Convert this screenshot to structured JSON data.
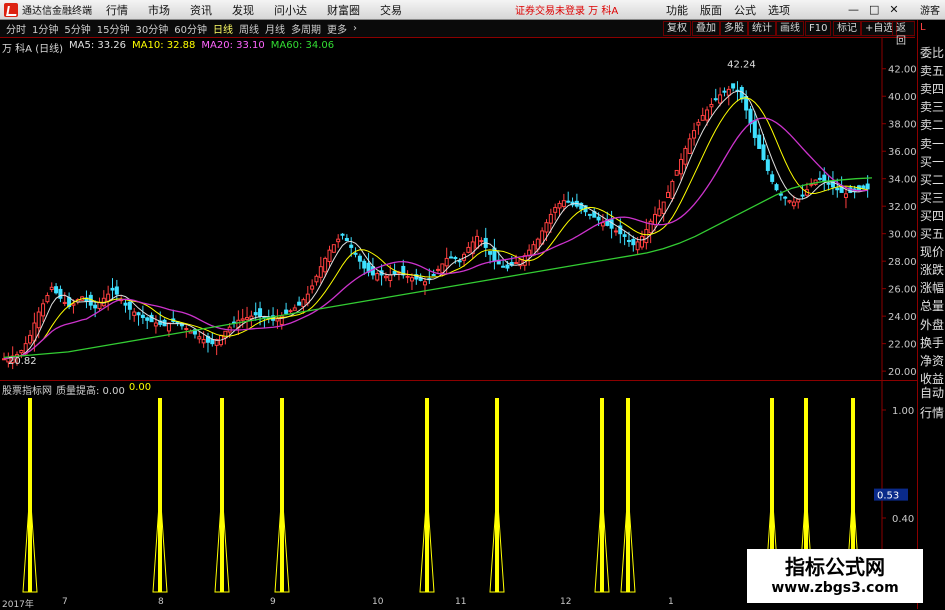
{
  "menubar": {
    "app_title": "通达信金融终端",
    "items": [
      "行情",
      "市场",
      "资讯",
      "发现",
      "问小达",
      "财富圈",
      "交易"
    ],
    "notice": "证券交易未登录  万 科A",
    "right_items": [
      "功能",
      "版面",
      "公式",
      "选项"
    ],
    "guest": "游客"
  },
  "periodbar": {
    "periods": [
      "分时",
      "1分钟",
      "5分钟",
      "15分钟",
      "30分钟",
      "60分钟",
      "日线",
      "周线",
      "月线",
      "多周期",
      "更多"
    ],
    "active_period": "日线",
    "tools": [
      "复权",
      "叠加",
      "多股",
      "统计",
      "画线",
      "F10",
      "标记",
      "+自选",
      "返回"
    ]
  },
  "chart_title": {
    "stock": "万 科A (日线)",
    "ma5": "MA5: 33.26",
    "ma10": "MA10: 32.88",
    "ma20": "MA20: 33.10",
    "ma60": "MA60: 34.06"
  },
  "price_axis": {
    "ticks": [
      "42.00",
      "40.00",
      "38.00",
      "36.00",
      "34.00",
      "32.00",
      "30.00",
      "28.00",
      "26.00",
      "24.00",
      "22.00",
      "20.00"
    ],
    "max_label": "42.24",
    "min_label": "20.82"
  },
  "indicator": {
    "name": "股票指标网",
    "label1": "质量提高: 0.00",
    "label2": "0.00",
    "axis_ticks": [
      "1.00",
      "0.40"
    ],
    "current_value": "0.53"
  },
  "dates": {
    "labels": [
      "2017年",
      "7",
      "8",
      "9",
      "10",
      "11",
      "12",
      "1"
    ]
  },
  "sidetabs": {
    "top_marker": "L",
    "tabs": [
      "委比",
      "卖五",
      "卖四",
      "卖三",
      "卖二",
      "卖一",
      "买一",
      "买二",
      "买三",
      "买四",
      "买五",
      "现价",
      "涨跌",
      "涨幅",
      "总量",
      "外盘",
      "换手",
      "净资",
      "收益",
      "自动",
      "行情"
    ]
  },
  "watermark": {
    "line1": "指标公式网",
    "line2": "www.zbgs3.com"
  },
  "colors": {
    "up": "#ff4040",
    "down": "#3fe0ff",
    "ma5": "#e0e0e0",
    "ma10": "#ffff00",
    "ma20": "#cc33cc",
    "ma60": "#33cc33",
    "signal": "#ffff00"
  },
  "chart_data": {
    "type": "candlestick",
    "ylim": [
      19.5,
      43
    ],
    "closes": [
      20.9,
      21.0,
      21.1,
      21.2,
      21.5,
      22.0,
      22.6,
      23.5,
      24.3,
      24.9,
      25.5,
      26.1,
      25.7,
      25.3,
      25.0,
      24.7,
      24.9,
      25.2,
      25.4,
      25.1,
      24.8,
      24.6,
      25.0,
      25.3,
      25.6,
      25.9,
      25.6,
      25.2,
      24.8,
      24.5,
      24.3,
      24.1,
      23.9,
      23.7,
      23.6,
      23.5,
      23.4,
      23.3,
      23.5,
      23.6,
      23.5,
      23.3,
      23.1,
      22.9,
      22.7,
      22.5,
      22.3,
      22.1,
      22.0,
      22.3,
      22.6,
      22.9,
      23.2,
      23.5,
      23.7,
      23.8,
      23.9,
      24.0,
      24.1,
      24.0,
      23.9,
      23.8,
      23.7,
      23.8,
      24.0,
      24.2,
      24.4,
      24.6,
      24.8,
      25.2,
      25.6,
      26.2,
      26.9,
      27.6,
      28.2,
      28.8,
      29.2,
      29.6,
      29.9,
      29.5,
      29.0,
      28.5,
      28.0,
      27.5,
      27.2,
      27.0,
      27.1,
      27.0,
      26.9,
      27.0,
      27.1,
      27.2,
      27.0,
      26.9,
      26.8,
      26.7,
      26.6,
      26.5,
      26.7,
      27.0,
      27.4,
      27.8,
      28.2,
      28.3,
      28.2,
      28.0,
      28.5,
      29.0,
      29.4,
      29.8,
      29.5,
      29.0,
      28.5,
      28.0,
      27.8,
      27.6,
      27.5,
      27.7,
      27.9,
      28.1,
      28.4,
      28.8,
      29.2,
      29.6,
      30.2,
      30.8,
      31.4,
      31.9,
      32.2,
      32.4,
      32.3,
      32.1,
      32.0,
      31.8,
      31.6,
      31.4,
      31.2,
      31.0,
      30.8,
      30.6,
      30.4,
      30.2,
      30.0,
      29.8,
      29.5,
      29.2,
      29.4,
      29.8,
      30.3,
      30.9,
      31.4,
      31.8,
      32.3,
      33.0,
      33.8,
      34.6,
      35.4,
      36.2,
      36.9,
      37.5,
      38.1,
      38.6,
      39.0,
      39.4,
      39.8,
      40.1,
      40.3,
      40.5,
      40.6,
      40.4,
      39.8,
      39.0,
      38.0,
      37.0,
      36.2,
      35.4,
      34.6,
      33.8,
      33.2,
      32.8,
      32.6,
      32.4,
      32.3,
      32.5,
      32.8,
      33.2,
      33.6,
      33.9,
      34.0,
      33.8,
      33.6,
      33.4,
      33.2,
      33.0,
      32.9,
      33.0,
      33.1,
      33.2,
      33.3,
      33.26
    ],
    "ma60": [
      21.0,
      21.1,
      21.2,
      21.3,
      21.4,
      21.6,
      21.8,
      22.0,
      22.2,
      22.4,
      22.6,
      22.8,
      23.0,
      23.2,
      23.4,
      23.6,
      23.8,
      24.0,
      24.2,
      24.4,
      24.6,
      24.8,
      25.0,
      25.2,
      25.4,
      25.6,
      25.8,
      26.0,
      26.2,
      26.4,
      26.6,
      26.8,
      27.0,
      27.2,
      27.4,
      27.6,
      27.8,
      28.0,
      28.2,
      28.4,
      28.6,
      28.9,
      29.3,
      29.8,
      30.4,
      31.0,
      31.6,
      32.2,
      32.8,
      33.3,
      33.6,
      33.8,
      33.9,
      34.0,
      34.06
    ],
    "signal_positions": [
      30,
      160,
      222,
      282,
      427,
      497,
      602,
      628,
      772,
      806,
      853
    ]
  }
}
